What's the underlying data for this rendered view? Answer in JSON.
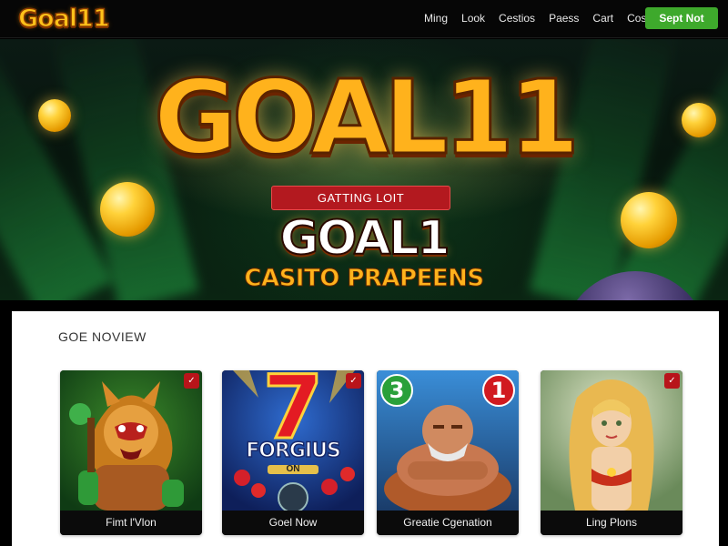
{
  "nav": {
    "logo": "Goal11",
    "links": [
      "Ming",
      "Look",
      "Cestios",
      "Paess",
      "Cart",
      "Cost"
    ],
    "cta_label": "Sept Not"
  },
  "hero": {
    "title": "GOAL11",
    "badge": "GATTING LOIT",
    "subtitle": "GOAL1",
    "tagline": "CASITO PRAPEENS"
  },
  "section": {
    "title": "GOE NOVIEW",
    "cards": [
      {
        "caption": "Fimt l'Vlon",
        "art": "lion-warrior"
      },
      {
        "caption": "Goel Now",
        "art": "lucky-seven-slot",
        "art_text": "FORGIUS",
        "art_sub": "ON",
        "art_number": "7"
      },
      {
        "caption": "Greatie Cgenation",
        "art": "strongman",
        "badges": [
          "3",
          "1"
        ]
      },
      {
        "caption": "Ling Plons",
        "art": "golden-goddess"
      }
    ]
  },
  "colors": {
    "accent_gold": "#ffb21c",
    "cta_green": "#3ea92c",
    "badge_red": "#b3191f"
  },
  "icons": [
    "heart-icon"
  ]
}
